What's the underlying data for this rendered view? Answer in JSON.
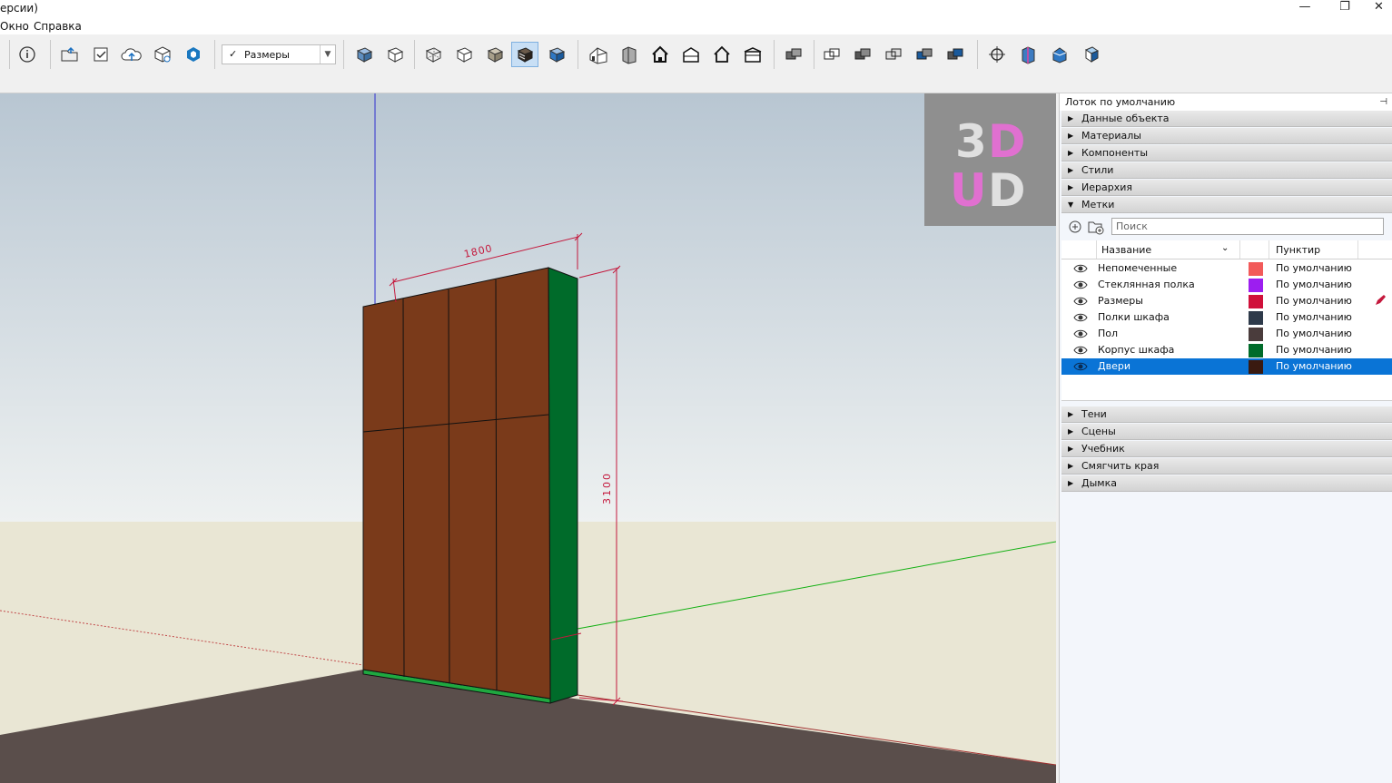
{
  "window": {
    "title": "ерсии)",
    "minimize": "—",
    "maximize": "❐",
    "close": "✕"
  },
  "menu": {
    "items": [
      "Окно",
      "Справка"
    ]
  },
  "toolbar": {
    "dropdown": {
      "check": "✓",
      "value": "Размеры"
    },
    "icons": [
      "info-icon",
      "open-folder-icon",
      "checkbox-icon",
      "cloud-upload-icon",
      "3d-warehouse-icon",
      "extension-icon",
      "iso-view-icon",
      "top-view-icon",
      "front-view-icon",
      "right-view-icon",
      "back-view-icon",
      "left-view-icon",
      "bottom-view-icon",
      "xray-icon",
      "wireframe-icon",
      "hidden-line-icon",
      "shaded-icon",
      "shaded-texture-icon",
      "house-iso-icon",
      "house-front-icon",
      "house-top-icon",
      "house-right-icon",
      "house-back-icon",
      "house-left-icon",
      "solid-tools-icon",
      "outer-shell-icon",
      "intersect-icon",
      "union-icon",
      "subtract-icon",
      "trim-icon",
      "position-camera-icon",
      "walk-icon",
      "look-around-icon",
      "section-plane-icon"
    ]
  },
  "viewport": {
    "logo": {
      "line1a": "3",
      "line1b": "D",
      "line2a": "U",
      "line2b": "D"
    },
    "dim_width": "1800",
    "dim_height": "3100",
    "colors": {
      "doors": "#7a3a1a",
      "body": "#006b2a",
      "dimension": "#c4183c",
      "floor": "#5a4e4b",
      "ground": "#e9e6d4"
    }
  },
  "panel": {
    "title": "Лоток по умолчанию",
    "pin": "⊣",
    "sections_top": [
      "Данные объекта",
      "Материалы",
      "Компоненты",
      "Стили",
      "Иерархия"
    ],
    "open_section": "Метки",
    "search_placeholder": "Поиск",
    "columns": {
      "name": "Название",
      "dash": "Пунктир"
    },
    "layers": [
      {
        "name": "Непомеченные",
        "color": "#f25a5a",
        "dash": "По умолчанию"
      },
      {
        "name": "Стеклянная полка",
        "color": "#9c1ef0",
        "dash": "По умолчанию"
      },
      {
        "name": "Размеры",
        "color": "#d0103a",
        "dash": "По умолчанию"
      },
      {
        "name": "Полки шкафа",
        "color": "#2e3a4a",
        "dash": "По умолчанию"
      },
      {
        "name": "Пол",
        "color": "#4a3c3c",
        "dash": "По умолчанию"
      },
      {
        "name": "Корпус шкафа",
        "color": "#006b2a",
        "dash": "По умолчанию"
      },
      {
        "name": "Двери",
        "color": "#3a1a10",
        "dash": "По умолчанию",
        "selected": true
      }
    ],
    "sections_bottom": [
      "Тени",
      "Сцены",
      "Учебник",
      "Смягчить края",
      "Дымка"
    ]
  }
}
